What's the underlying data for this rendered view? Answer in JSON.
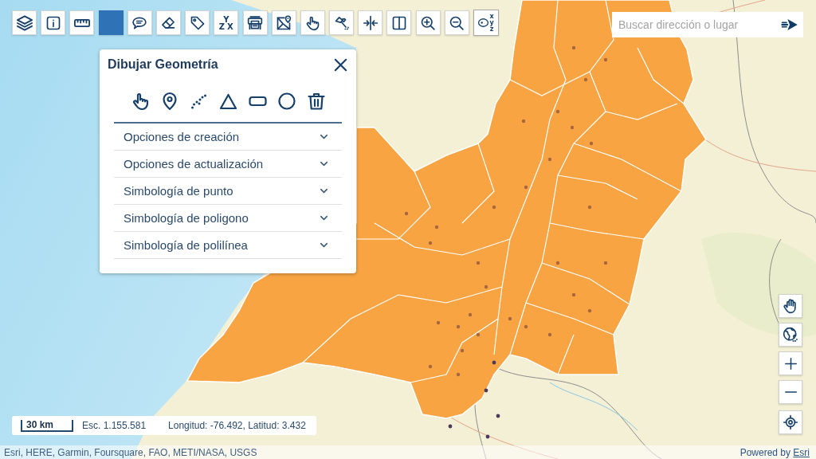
{
  "toolbar": {
    "tools": [
      {
        "kind": "icon",
        "selected": false
      },
      {
        "kind": "icon",
        "selected": false
      },
      {
        "kind": "icon",
        "selected": false
      },
      {
        "kind": "icon",
        "selected": true
      },
      {
        "kind": "icon",
        "selected": false
      },
      {
        "kind": "icon",
        "selected": false
      },
      {
        "kind": "icon",
        "selected": false
      },
      {
        "kind": "letters",
        "selected": false,
        "letters": [
          "Y",
          "Z",
          "X"
        ]
      },
      {
        "kind": "icon",
        "selected": false
      },
      {
        "kind": "icon",
        "selected": false
      },
      {
        "kind": "icon",
        "selected": false
      },
      {
        "kind": "icon",
        "selected": false
      },
      {
        "kind": "icon",
        "selected": false
      },
      {
        "kind": "icon",
        "selected": false
      },
      {
        "kind": "icon",
        "selected": false
      },
      {
        "kind": "icon",
        "selected": false
      },
      {
        "kind": "icon-letters",
        "selected": false,
        "letters": [
          "x",
          "y",
          "z"
        ]
      }
    ]
  },
  "search": {
    "placeholder": "Buscar dirección o lugar"
  },
  "draw_panel": {
    "title": "Dibujar Geometría",
    "sections": [
      {
        "label": "Opciones de creación",
        "expanded": false
      },
      {
        "label": "Opciones de actualización",
        "expanded": false
      },
      {
        "label": "Simbología de punto",
        "expanded": false
      },
      {
        "label": "Simbología de poligono",
        "expanded": false
      },
      {
        "label": "Simbología de polilínea",
        "expanded": false
      }
    ]
  },
  "scale_bar": {
    "distance": "30 km",
    "scale": "Esc. 1.155.581",
    "coordinates": "Longitud: -76.492, Latitud: 3.432"
  },
  "attribution": {
    "sources": "Esri, HERE, Garmin, Foursquare, FAO, METI/NASA, USGS",
    "powered_by": "Powered by",
    "link": "Esri"
  }
}
